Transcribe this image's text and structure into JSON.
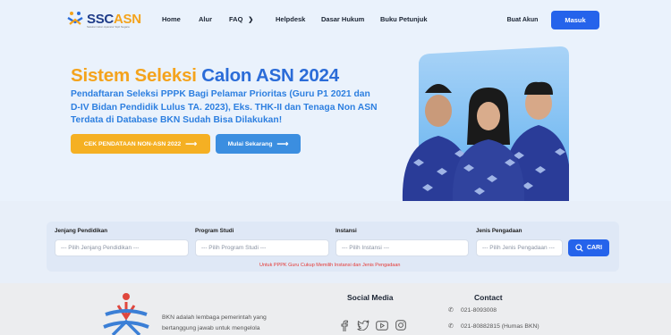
{
  "header": {
    "logo_ssc": "SSC",
    "logo_asn": "ASN",
    "logo_sub": "Seleksi Calon Aparatur Sipil Negara",
    "nav": [
      {
        "label": "Home"
      },
      {
        "label": "Alur"
      },
      {
        "label": "FAQ"
      },
      {
        "label": "Helpdesk"
      },
      {
        "label": "Dasar Hukum"
      },
      {
        "label": "Buku Petunjuk"
      }
    ],
    "buat_akun": "Buat Akun",
    "masuk": "Masuk"
  },
  "hero": {
    "title_part1": "Sistem Seleksi ",
    "title_part2": "Calon ASN 2024",
    "subtitle": "Pendaftaran Seleksi PPPK Bagi Pelamar Prioritas (Guru P1 2021 dan D-IV Bidan Pendidik Lulus TA. 2023), Eks. THK-II dan Tenaga Non ASN Terdata di Database BKN Sudah Bisa Dilakukan!",
    "btn_cek": "CEK PENDATAAN NON-ASN 2022",
    "btn_mulai": "Mulai Sekarang"
  },
  "search": {
    "fields": [
      {
        "label": "Jenjang Pendidikan",
        "placeholder": "--- Pilih Jenjang Pendidikan ---"
      },
      {
        "label": "Program Studi",
        "placeholder": "--- Pilih Program Studi ---"
      },
      {
        "label": "Instansi",
        "placeholder": "--- Pilih Instansi ---"
      },
      {
        "label": "Jenis Pengadaan",
        "placeholder": "--- Pilih Jenis Pengadaan ---"
      }
    ],
    "cari": "CARI",
    "note": "Untuk PPPK Guru Cukup Memilih Instansi dan Jenis Pengadaan"
  },
  "footer": {
    "desc": "BKN adalah lembaga pemerintah yang bertanggung jawab untuk mengelola",
    "social_heading": "Social Media",
    "social_icons": [
      "facebook-icon",
      "twitter-icon",
      "youtube-icon",
      "instagram-icon"
    ],
    "contact_heading": "Contact",
    "phones": [
      "021-8093008",
      "021-80882815 (Humas BKN)"
    ]
  },
  "colors": {
    "brand_blue": "#2563eb",
    "accent_orange": "#f4a31c",
    "hero_blue": "#2d7fe0"
  }
}
